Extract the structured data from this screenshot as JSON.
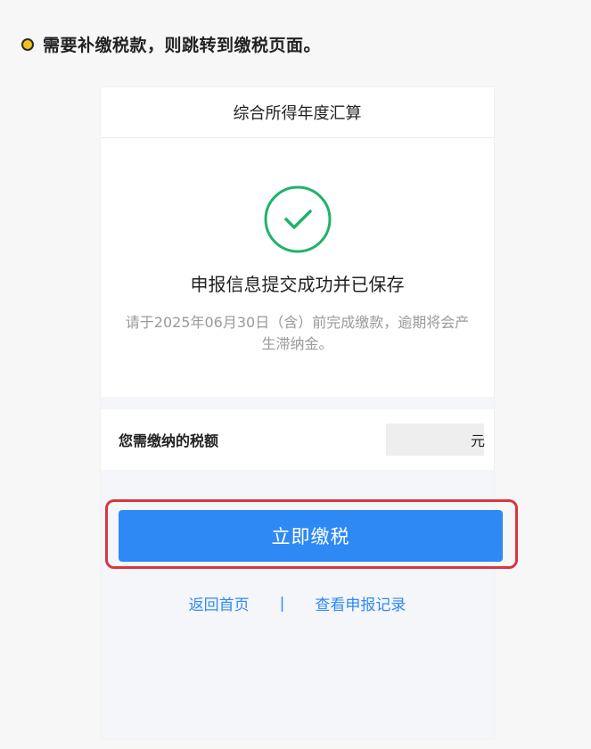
{
  "note": {
    "text": "需要补缴税款，则跳转到缴税页面。"
  },
  "screen": {
    "header_title": "综合所得年度汇算",
    "status": {
      "title": "申报信息提交成功并已保存",
      "description": "请于2025年06月30日（含）前完成缴款，逾期将会产生滞纳金。",
      "icon": "success-check-icon",
      "icon_color": "#20b26b"
    },
    "tax": {
      "label": "您需缴纳的税额",
      "amount": "",
      "unit": "元"
    },
    "pay_button_label": "立即缴税",
    "links": {
      "home": "返回首页",
      "separator": "|",
      "records": "查看申报记录"
    }
  },
  "colors": {
    "primary": "#2f89f5",
    "highlight": "#d9363e",
    "note_dot": "#f2c21b"
  }
}
